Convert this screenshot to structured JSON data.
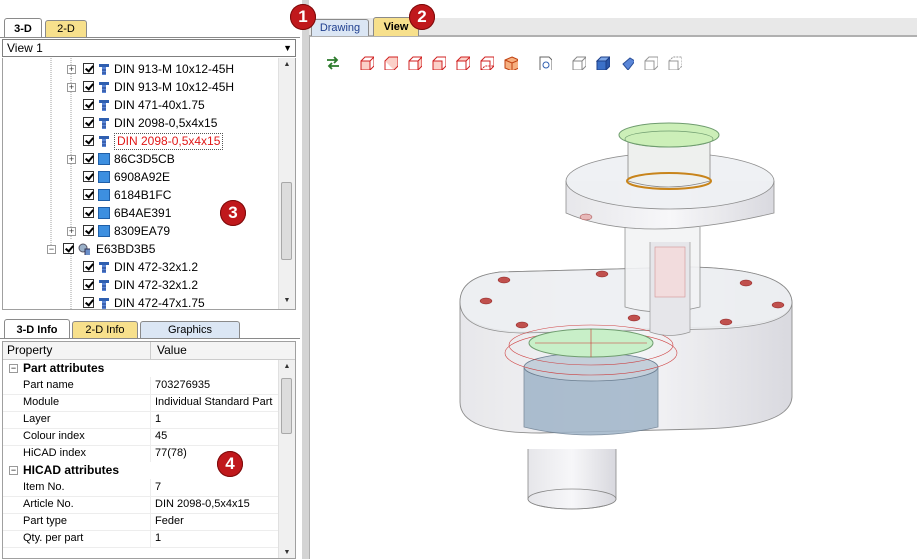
{
  "left_tabs": [
    {
      "label": "3-D"
    },
    {
      "label": "2-D"
    }
  ],
  "view_select": {
    "value": "View 1"
  },
  "tree": {
    "items": [
      {
        "label": "DIN 913-M 10x12-45H",
        "kind": "bolt",
        "expandable": true
      },
      {
        "label": "DIN 913-M 10x12-45H",
        "kind": "bolt",
        "expandable": true
      },
      {
        "label": "DIN 471-40x1.75",
        "kind": "bolt",
        "expandable": false
      },
      {
        "label": "DIN 2098-0,5x4x15",
        "kind": "bolt",
        "expandable": false
      },
      {
        "label": "DIN 2098-0,5x4x15",
        "kind": "bolt",
        "expandable": false,
        "selected": true
      },
      {
        "label": "86C3D5CB",
        "kind": "box",
        "expandable": true
      },
      {
        "label": "6908A92E",
        "kind": "box",
        "expandable": false
      },
      {
        "label": "6184B1FC",
        "kind": "box",
        "expandable": false
      },
      {
        "label": "6B4AE391",
        "kind": "box",
        "expandable": false
      },
      {
        "label": "8309EA79",
        "kind": "box",
        "expandable": true
      },
      {
        "label": "E63BD3B5",
        "kind": "assembly",
        "expandable": true
      },
      {
        "label": "DIN 472-32x1.2",
        "kind": "bolt",
        "expandable": false
      },
      {
        "label": "DIN 472-32x1.2",
        "kind": "bolt",
        "expandable": false
      },
      {
        "label": "DIN 472-47x1.75",
        "kind": "bolt",
        "expandable": false
      }
    ]
  },
  "info_tabs": [
    {
      "label": "3-D Info"
    },
    {
      "label": "2-D Info"
    },
    {
      "label": "Graphics"
    }
  ],
  "property_grid": {
    "col_property": "Property",
    "col_value": "Value",
    "groups": [
      {
        "title": "Part attributes",
        "rows": [
          {
            "k": "Part name",
            "v": "703276935"
          },
          {
            "k": "Module",
            "v": "Individual Standard Part"
          },
          {
            "k": "Layer",
            "v": "1"
          },
          {
            "k": "Colour index",
            "v": "45"
          },
          {
            "k": "HiCAD index",
            "v": "77(78)"
          }
        ]
      },
      {
        "title": "HICAD attributes",
        "rows": [
          {
            "k": "Item No.",
            "v": "7"
          },
          {
            "k": "Article No.",
            "v": "DIN 2098-0,5x4x15"
          },
          {
            "k": "Part type",
            "v": "Feder"
          },
          {
            "k": "Qty. per part",
            "v": "1"
          }
        ]
      }
    ]
  },
  "view_tabs": [
    {
      "label": "Drawing"
    },
    {
      "label": "View"
    }
  ],
  "callouts": [
    "1",
    "2",
    "3",
    "4"
  ],
  "colors": {
    "callout": "#c0181c",
    "selected_text": "#e01818",
    "tab_yellow": "#f7e08c"
  }
}
